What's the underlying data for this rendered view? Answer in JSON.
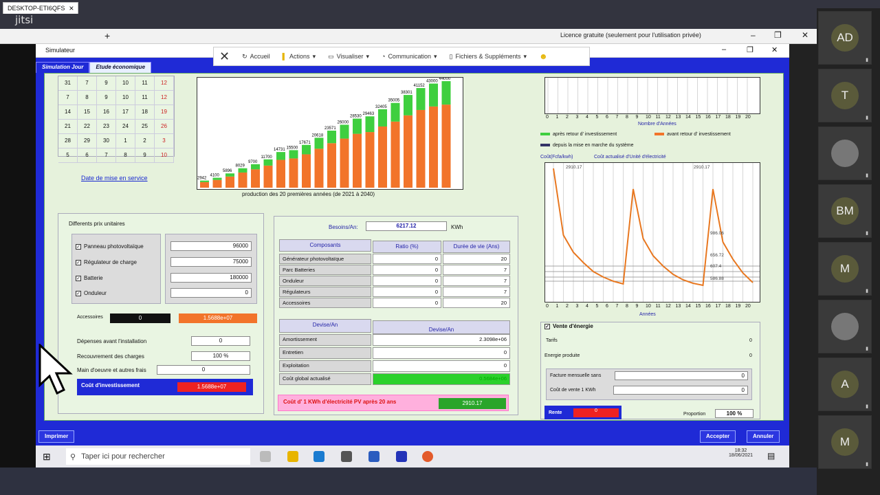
{
  "jitsi": {
    "logo": "jitsi"
  },
  "remote": {
    "tab": "DESKTOP-ETI6QFS",
    "close": "×",
    "plus": "+",
    "license": "Licence gratuite (seulement pour l'utilisation privée)",
    "min": "–",
    "max": "❐",
    "close_win": "✕"
  },
  "app": {
    "title": "Simulateur",
    "tabs": [
      "Simulation Jour",
      "Etude économique"
    ]
  },
  "anydesk": {
    "items": [
      "Accueil",
      "Actions",
      "Visualiser",
      "Communication",
      "Fichiers & Suppléments"
    ]
  },
  "calendar": {
    "rows": [
      [
        "31",
        "7",
        "9",
        "10",
        "11",
        "12"
      ],
      [
        "7",
        "8",
        "9",
        "10",
        "11",
        "12"
      ],
      [
        "14",
        "15",
        "16",
        "17",
        "18",
        "19"
      ],
      [
        "21",
        "22",
        "23",
        "24",
        "25",
        "26"
      ],
      [
        "28",
        "29",
        "30",
        "1",
        "2",
        "3"
      ],
      [
        "5",
        "6",
        "7",
        "8",
        "9",
        "10"
      ]
    ],
    "red_col": 5,
    "link": "Date de mise en service"
  },
  "prod_chart": {
    "caption": "production des 20 premières années (de 2021 à 2040)"
  },
  "chart_data": [
    {
      "type": "bar",
      "series": [
        {
          "name": "",
          "values": [
            2942,
            4100,
            5896,
            8029,
            9700,
            11700,
            14731,
            15500,
            17671,
            20618,
            23571,
            26000,
            28530,
            29463,
            32405,
            35005,
            38301,
            41152,
            43000,
            44000
          ]
        }
      ]
    },
    {
      "type": "line",
      "title": "Coût actualisé d'Unité d'électricité",
      "ylabel": "Coût(Fcfa/kwh)",
      "xlabel": "Années",
      "x": [
        0,
        1,
        2,
        3,
        4,
        5,
        6,
        7,
        8,
        9,
        10,
        11,
        12,
        13,
        14,
        15,
        16,
        17,
        18,
        19,
        20
      ],
      "annotations": [
        "2910.17",
        "2910.17",
        "986.06",
        "656.72",
        "607.4",
        "586.88"
      ]
    }
  ],
  "prix": {
    "title": "Differents prix unitaires",
    "items": [
      {
        "label": "Panneau photovoltaïque",
        "value": "96000"
      },
      {
        "label": "Régulateur de charge",
        "value": "75000"
      },
      {
        "label": "Batterie",
        "value": "180000"
      },
      {
        "label": "Onduleur",
        "value": "0"
      }
    ],
    "accessoires_label": "Accessoires",
    "accessoires_val1": "0",
    "accessoires_val2": "1.5688e+07",
    "dep_label": "Dépenses avant l'installation",
    "dep_val": "0",
    "rec_label": "Recouvrement des charges",
    "rec_val": "100 %",
    "main_label": "Main d'oeuvre et autres frais",
    "main_val": "0",
    "cout_label": "Coût d'investissement",
    "cout_val": "1.5688e+07"
  },
  "mid": {
    "besoin_label": "Besoins/An:",
    "besoin_val": "6217.12",
    "besoin_unit": "KWh",
    "h_comp": "Composants",
    "h_ratio": "Ratio (%)",
    "h_duree": "Durée de vie (Ans)",
    "rows": [
      {
        "c": "Générateur photovoltaïque",
        "r": "0",
        "d": "20"
      },
      {
        "c": "Parc Batteries",
        "r": "0",
        "d": "7"
      },
      {
        "c": "Onduleur",
        "r": "0",
        "d": "7"
      },
      {
        "c": "Régulateurs",
        "r": "0",
        "d": "7"
      },
      {
        "c": "Accessoires",
        "r": "0",
        "d": "20"
      }
    ],
    "h_dev1": "Devise/An",
    "h_dev2": "Devise/An",
    "rows2": [
      {
        "c": "Amortissement",
        "v": "2.3098e+06"
      },
      {
        "c": "Entretien",
        "v": "0"
      },
      {
        "c": "Exploitation",
        "v": "0"
      },
      {
        "c": "Coût global actualisé",
        "v": "0.5684e+06"
      }
    ],
    "pv_text": "Coût d' 1 KWh d'électricité PV après 20   ans",
    "pv_val": "2910.17"
  },
  "right": {
    "top_xlabel": "Nombre d'Années",
    "legend1": "après retour d' investissement",
    "legend2": "avant retour d' investissement",
    "legend3": "depuis la mise en marche du système",
    "vente_title": "Vente d'énergie",
    "tarif": "Tarifs",
    "tarif_val": "0",
    "energie": "Energie produite",
    "energie_val": "0",
    "facture": "Facture mensuelle sans",
    "facture_val": "0",
    "cout_vente": "Coût de vente 1 KWh",
    "cout_vente_val": "0",
    "rente": "Rente",
    "rente_val": "0",
    "proportion": "Proportion",
    "proportion_val": "100 %"
  },
  "buttons": {
    "print": "Imprimer",
    "accept": "Accepter",
    "cancel": "Annuler"
  },
  "taskbar": {
    "search": "Taper ici pour rechercher",
    "time": "18:32",
    "date": "18/06/2021"
  },
  "participants": [
    "AD",
    "T",
    "",
    "BM",
    "M",
    "",
    "A",
    "M"
  ],
  "colors": {
    "app_blue": "#1f2ad6",
    "bar_green": "#3fcf3f",
    "bar_orange": "#f2742a",
    "line_orange": "#e8771f"
  }
}
